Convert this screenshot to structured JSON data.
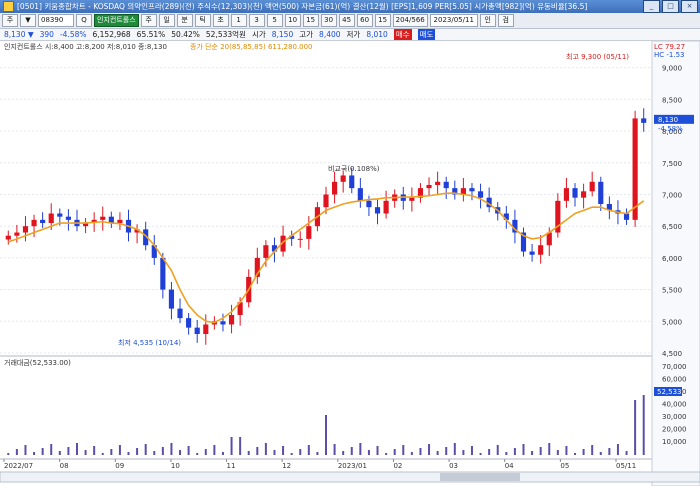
{
  "window": {
    "title": "[0501] 키움종합차트 - KOSDAQ 의약인프라(289)(전) 주식수(12,303)(천) 액면(500) 자본금(61)(억) 결산(12월) [EPS]1,609 PER[5.05] 시가총액[982](억) 유동비율[36.5]",
    "buttons": [
      "_",
      "□",
      "×"
    ]
  },
  "toolbar": {
    "items": [
      "주",
      "▼",
      "Q",
      "인",
      "검"
    ],
    "code": "08390",
    "stock_name": "인지컨트롤스",
    "periods": [
      "주",
      "일",
      "분",
      "틱",
      "초",
      "1",
      "3",
      "5",
      "10",
      "15",
      "30",
      "45",
      "60",
      "15"
    ],
    "zoom": "204/566",
    "date": "2023/05/11"
  },
  "infobar": {
    "price": "8,130 ▼",
    "change": "390",
    "rate": "-4.58%",
    "volume": "6,152,968",
    "turnover": "65.51%",
    "amount": "50.42%",
    "vol2": "52,533억원",
    "label_open": "시가",
    "open": "8,150",
    "label_high": "고가",
    "high": "8,400",
    "label_low": "저가",
    "low": "8,010",
    "buy": "매수",
    "sell": "매도"
  },
  "chart": {
    "legend_main": "인지컨트롤스 시:8,400 고:8,200 저:8,010 종:8,130",
    "legend_ma": "종가 단순 20(85,85,85)  611,280.000",
    "max_label": "최고 9,300 (05/11)",
    "min_label": "최저 4,535 (10/14)",
    "event_label": "비교국(0.108%)",
    "lc_label": "LC 79.27",
    "hc_label": "HC -1.53",
    "price_tag": "8,130",
    "price_change_tag": "-4.58%",
    "y_ticks": [
      "9,000",
      "8,500",
      "8,000",
      "7,500",
      "7,000",
      "6,500",
      "6,000",
      "5,500",
      "5,000",
      "4,500"
    ],
    "volume_legend": "거래대금(52,533.00)",
    "volume_ticks": [
      "70,000",
      "60,000",
      "50,000",
      "40,000",
      "30,000",
      "20,000",
      "10,000"
    ],
    "volume_tag": "52,533",
    "x_labels": [
      "2022/07",
      "08",
      "09",
      "10",
      "11",
      "12",
      "2023/01",
      "02",
      "03",
      "04",
      "05",
      "05/11"
    ],
    "colors": {
      "up": "#e0141e",
      "down": "#1f3fd6",
      "ma": "#f0a020",
      "vol": "#5a4fa8"
    }
  },
  "chart_data": {
    "type": "line",
    "title": "",
    "series": [
      {
        "values": [
          6350,
          6400,
          6500,
          6600,
          6550,
          6700,
          6650,
          6600,
          6500,
          6550,
          6600,
          6650,
          6550,
          6600,
          6400,
          6450,
          6200,
          6000,
          5500,
          5200,
          5050,
          4900,
          4800,
          4950,
          5000,
          4950,
          5100,
          5300,
          5700,
          6000,
          6200,
          6100,
          6350,
          6300,
          6300,
          6500,
          6800,
          7000,
          7200,
          7300,
          7100,
          6900,
          6800,
          6700,
          6900,
          7000,
          6900,
          6950,
          7100,
          7150,
          7200,
          7100,
          7000,
          7100,
          7050,
          6950,
          6800,
          6700,
          6600,
          6400,
          6100,
          6050,
          6200,
          6400,
          6900,
          7100,
          6950,
          7050,
          7200,
          6850,
          6750,
          6700,
          6600,
          8200,
          8130
        ]
      },
      {
        "values": [
          6250,
          6300,
          6350,
          6400,
          6450,
          6500,
          6550,
          6550,
          6550,
          6550,
          6560,
          6570,
          6550,
          6540,
          6500,
          6450,
          6350,
          6200,
          6000,
          5800,
          5500,
          5250,
          5100,
          5000,
          4980,
          5050,
          5150,
          5300,
          5500,
          5750,
          5950,
          6100,
          6250,
          6350,
          6450,
          6550,
          6650,
          6750,
          6800,
          6850,
          6880,
          6900,
          6920,
          6930,
          6950,
          6950,
          6960,
          6960,
          6970,
          6980,
          7000,
          7020,
          7020,
          7000,
          6980,
          6930,
          6850,
          6750,
          6600,
          6450,
          6350,
          6300,
          6320,
          6400,
          6500,
          6600,
          6700,
          6750,
          6800,
          6800,
          6750,
          6720,
          6700,
          6800,
          6900
        ]
      }
    ],
    "ylim": [
      4500,
      9200
    ]
  }
}
